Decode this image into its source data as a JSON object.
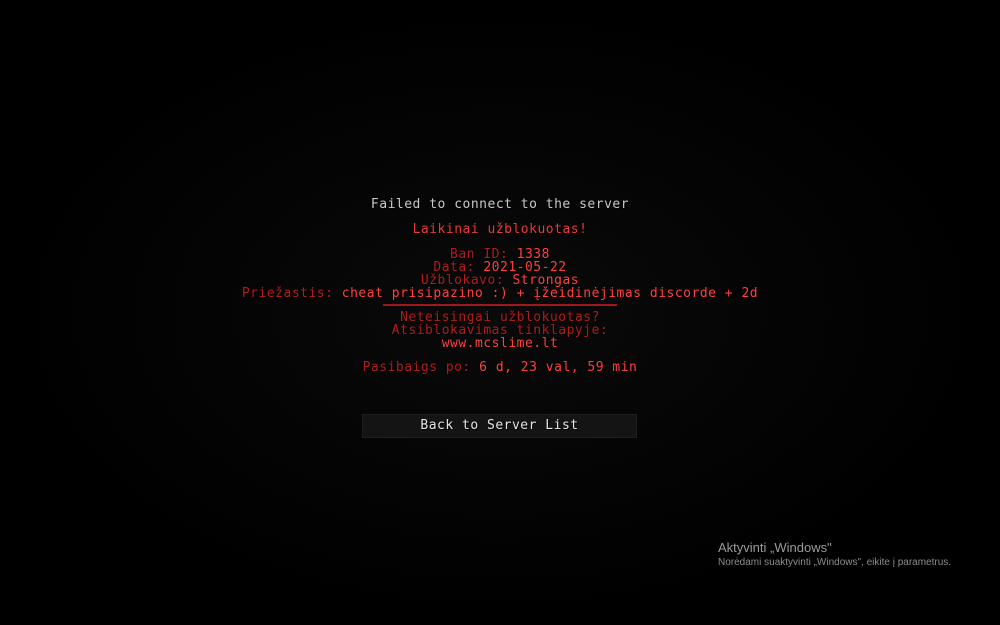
{
  "disconnect": {
    "title": "Failed to connect to the server",
    "status": "Laikinai užblokuotas!",
    "ban_id_label": "Ban ID:",
    "ban_id_value": "1338",
    "date_label": "Data:",
    "date_value": "2021-05-22",
    "blocked_by_label": "Užblokavo:",
    "blocked_by_value": "Strongas",
    "reason_label": "Priežastis:",
    "reason_value": "cheat prisipazino :) + įžeidinėjimas discorde + 2d",
    "appeal_question": "Neteisingai užblokuotas?",
    "appeal_label": "Atsiblokavimas tinklapyje:",
    "appeal_url": "www.mcslime.lt",
    "expires_label": "Pasibaigs po:",
    "expires_value": "6 d, 23 val, 59 min"
  },
  "actions": {
    "back_label": "Back to Server List"
  },
  "watermark": {
    "title": "Aktyvinti „Windows\"",
    "subtitle": "Norėdami suaktyvinti „Windows\", eikite į parametrus."
  },
  "colors": {
    "background": "#000000",
    "title_text": "#c8c8c8",
    "label_red": "#b01c1c",
    "value_red": "#ff4040"
  }
}
